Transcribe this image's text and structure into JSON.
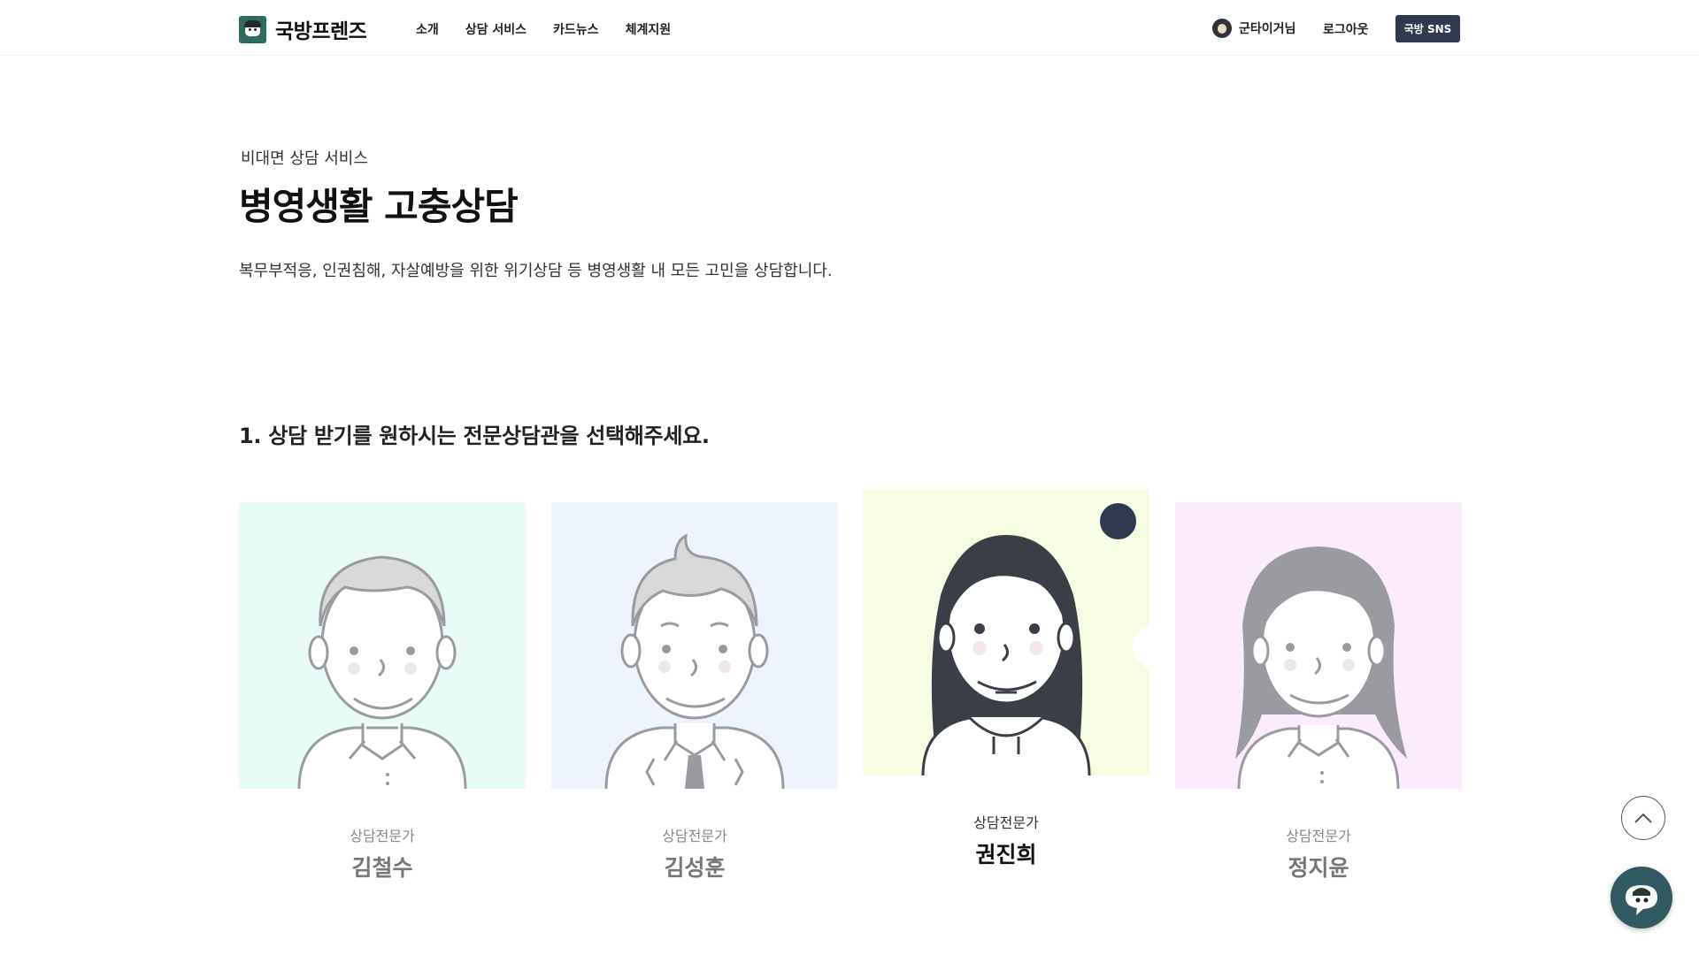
{
  "header": {
    "logo_text": "국방프렌즈",
    "nav": [
      "소개",
      "상담 서비스",
      "카드뉴스",
      "체계지원"
    ],
    "user_name": "군타이거님",
    "logout_label": "로그아웃",
    "sns_label": "국방 SNS"
  },
  "hero": {
    "subtitle": "비대면 상담 서비스",
    "title": "병영생활 고충상담",
    "description": "복무부적응, 인권침해, 자살예방을 위한 위기상담 등 병영생활 내 모든 고민을 상담합니다."
  },
  "step1": {
    "title": "1. 상담 받기를 원하시는 전문상담관을 선택해주세요."
  },
  "counselors": [
    {
      "role": "상담전문가",
      "name": "김철수",
      "bg": "#e8fcf7",
      "selected": false
    },
    {
      "role": "상담전문가",
      "name": "김성훈",
      "bg": "#eef4fe",
      "selected": false
    },
    {
      "role": "상담전문가",
      "name": "권진희",
      "bg": "#f7fde2",
      "selected": true
    },
    {
      "role": "상담전문가",
      "name": "정지윤",
      "bg": "#fbebfd",
      "selected": false
    }
  ],
  "colors": {
    "accent": "#2e3a4f",
    "chat": "#2f5a62",
    "logo": "#2f6b63"
  },
  "icons": {
    "check": "check-icon",
    "scroll_top": "chevron-up-icon",
    "chat": "chat-bot-icon"
  }
}
